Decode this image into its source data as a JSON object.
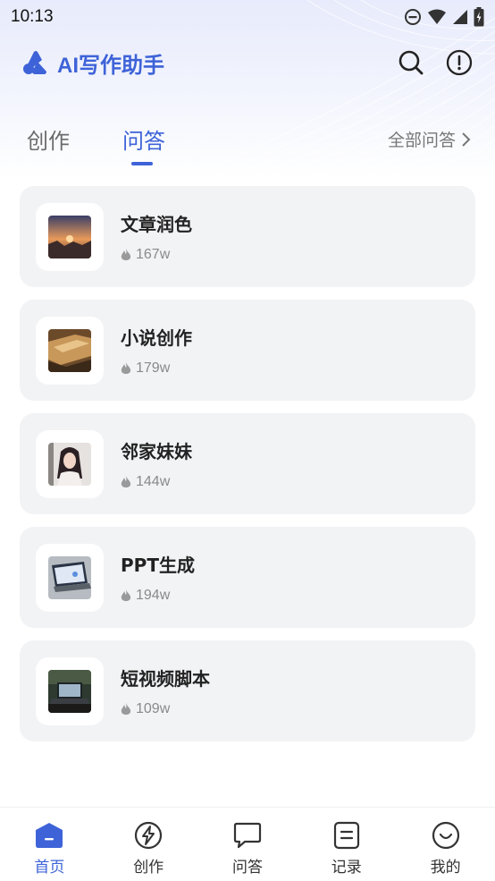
{
  "status_bar": {
    "time": "10:13"
  },
  "header": {
    "title": "AI写作助手"
  },
  "tabs": [
    {
      "label": "创作",
      "active": false
    },
    {
      "label": "问答",
      "active": true
    }
  ],
  "all_link": {
    "label": "全部问答"
  },
  "items": [
    {
      "title": "文章润色",
      "count": "167w"
    },
    {
      "title": "小说创作",
      "count": "179w"
    },
    {
      "title": "邻家妹妹",
      "count": "144w"
    },
    {
      "title": "PPT生成",
      "count": "194w"
    },
    {
      "title": "短视频脚本",
      "count": "109w"
    }
  ],
  "nav": [
    {
      "label": "首页",
      "icon": "home-icon",
      "active": true
    },
    {
      "label": "创作",
      "icon": "lightning-icon",
      "active": false
    },
    {
      "label": "问答",
      "icon": "chat-bubble-icon",
      "active": false
    },
    {
      "label": "记录",
      "icon": "note-icon",
      "active": false
    },
    {
      "label": "我的",
      "icon": "smile-icon",
      "active": false
    }
  ],
  "colors": {
    "accent": "#3e63d8",
    "card_bg": "#f2f3f5",
    "muted": "#8a8a8a"
  }
}
